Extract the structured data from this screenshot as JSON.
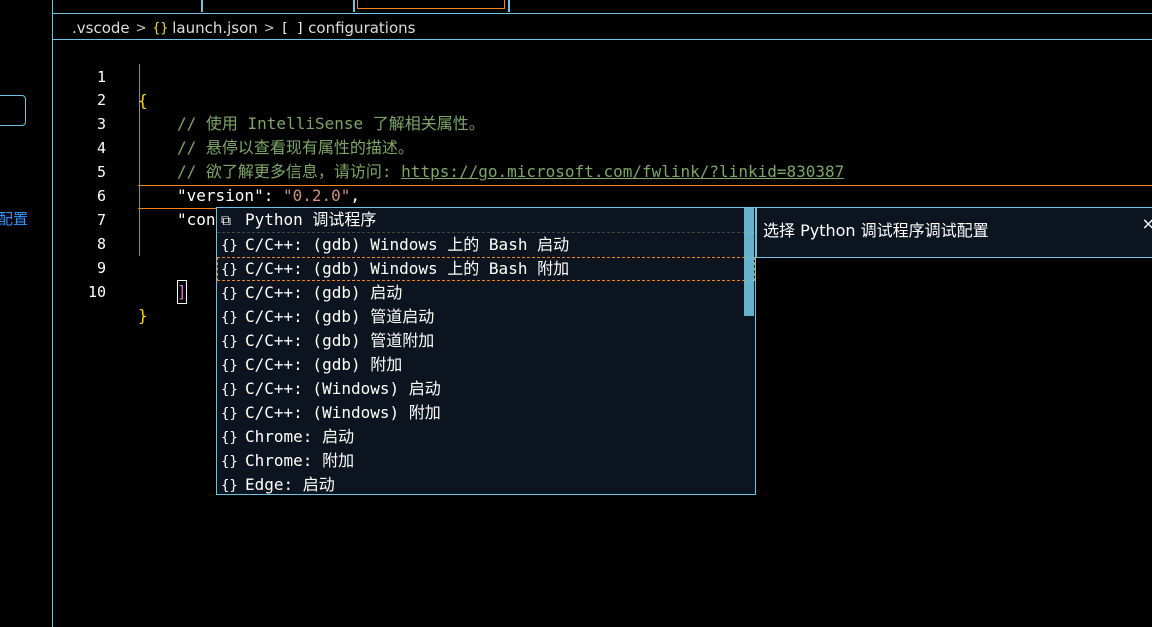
{
  "sidebar": {
    "cut_text": "配置"
  },
  "breadcrumb": {
    "items": [
      ".vscode",
      "launch.json",
      "configurations"
    ],
    "json_icon": "{}",
    "array_icon": "[ ]"
  },
  "editor": {
    "lines": [
      {
        "n": "1"
      },
      {
        "n": "2"
      },
      {
        "n": "3"
      },
      {
        "n": "4"
      },
      {
        "n": "5"
      },
      {
        "n": "6"
      },
      {
        "n": "7"
      },
      {
        "n": "8"
      },
      {
        "n": "9"
      },
      {
        "n": "10"
      }
    ],
    "l1": "{",
    "l2": "// 使用 IntelliSense 了解相关属性。",
    "l3": "// 悬停以查看现有属性的描述。",
    "l4_prefix": "// 欲了解更多信息，请访问: ",
    "l4_link": "https://go.microsoft.com/fwlink/?linkid=830387",
    "l5_key": "\"version\"",
    "l5_colon": ": ",
    "l5_val": "\"0.2.0\"",
    "l5_end": ",",
    "l6_key": "\"configurations\"",
    "l6_colon": ": ",
    "l6_bracket": "[",
    "l9_bracket": "]",
    "l10": "}"
  },
  "suggest": {
    "items": [
      {
        "icon": "python-snippet-icon",
        "glyph": "⧉",
        "label": "Python 调试程序"
      },
      {
        "icon": "braces-icon",
        "glyph": "{}",
        "label": "C/C++: (gdb) Windows 上的 Bash 启动"
      },
      {
        "icon": "braces-icon",
        "glyph": "{}",
        "label": "C/C++: (gdb) Windows 上的 Bash 附加"
      },
      {
        "icon": "braces-icon",
        "glyph": "{}",
        "label": "C/C++: (gdb) 启动"
      },
      {
        "icon": "braces-icon",
        "glyph": "{}",
        "label": "C/C++: (gdb) 管道启动"
      },
      {
        "icon": "braces-icon",
        "glyph": "{}",
        "label": "C/C++: (gdb) 管道附加"
      },
      {
        "icon": "braces-icon",
        "glyph": "{}",
        "label": "C/C++: (gdb) 附加"
      },
      {
        "icon": "braces-icon",
        "glyph": "{}",
        "label": "C/C++: (Windows) 启动"
      },
      {
        "icon": "braces-icon",
        "glyph": "{}",
        "label": "C/C++: (Windows) 附加"
      },
      {
        "icon": "braces-icon",
        "glyph": "{}",
        "label": "Chrome: 启动"
      },
      {
        "icon": "braces-icon",
        "glyph": "{}",
        "label": "Chrome: 附加"
      },
      {
        "icon": "braces-icon",
        "glyph": "{}",
        "label": "Edge: 启动"
      }
    ],
    "detail_text": "选择 Python 调试程序调试配置",
    "close_glyph": "×"
  },
  "colors": {
    "border": "#6fc3df",
    "focus": "#f38518",
    "comment": "#7ca668",
    "string": "#ce9178",
    "brace": "#ffd700"
  }
}
